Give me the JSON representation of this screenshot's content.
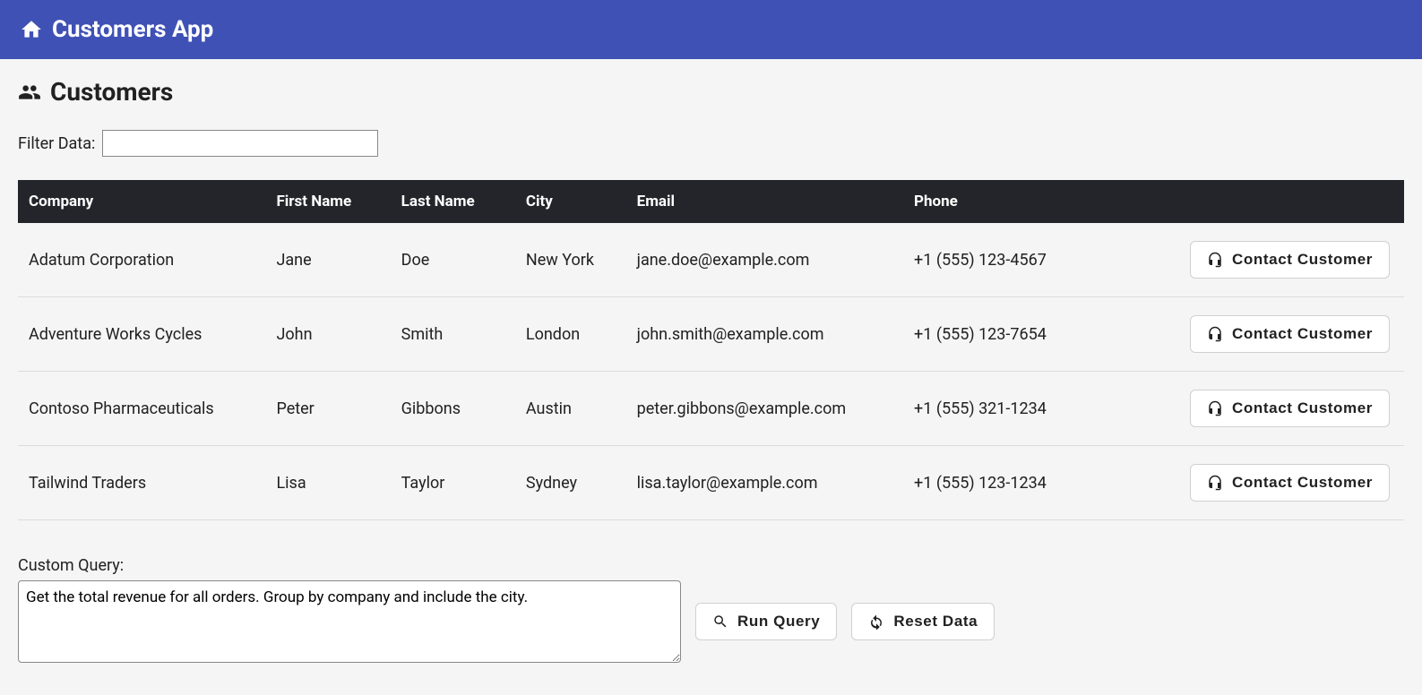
{
  "header": {
    "title": "Customers App"
  },
  "page": {
    "title": "Customers",
    "filter_label": "Filter Data:",
    "filter_value": ""
  },
  "table": {
    "columns": [
      "Company",
      "First Name",
      "Last Name",
      "City",
      "Email",
      "Phone"
    ],
    "contact_button_label": "Contact Customer",
    "rows": [
      {
        "company": "Adatum Corporation",
        "first_name": "Jane",
        "last_name": "Doe",
        "city": "New York",
        "email": "jane.doe@example.com",
        "phone": "+1 (555) 123-4567"
      },
      {
        "company": "Adventure Works Cycles",
        "first_name": "John",
        "last_name": "Smith",
        "city": "London",
        "email": "john.smith@example.com",
        "phone": "+1 (555) 123-7654"
      },
      {
        "company": "Contoso Pharmaceuticals",
        "first_name": "Peter",
        "last_name": "Gibbons",
        "city": "Austin",
        "email": "peter.gibbons@example.com",
        "phone": "+1 (555) 321-1234"
      },
      {
        "company": "Tailwind Traders",
        "first_name": "Lisa",
        "last_name": "Taylor",
        "city": "Sydney",
        "email": "lisa.taylor@example.com",
        "phone": "+1 (555) 123-1234"
      }
    ]
  },
  "query": {
    "label": "Custom Query:",
    "value": "Get the total revenue for all orders. Group by company and include the city.",
    "run_label": "Run Query",
    "reset_label": "Reset Data"
  }
}
